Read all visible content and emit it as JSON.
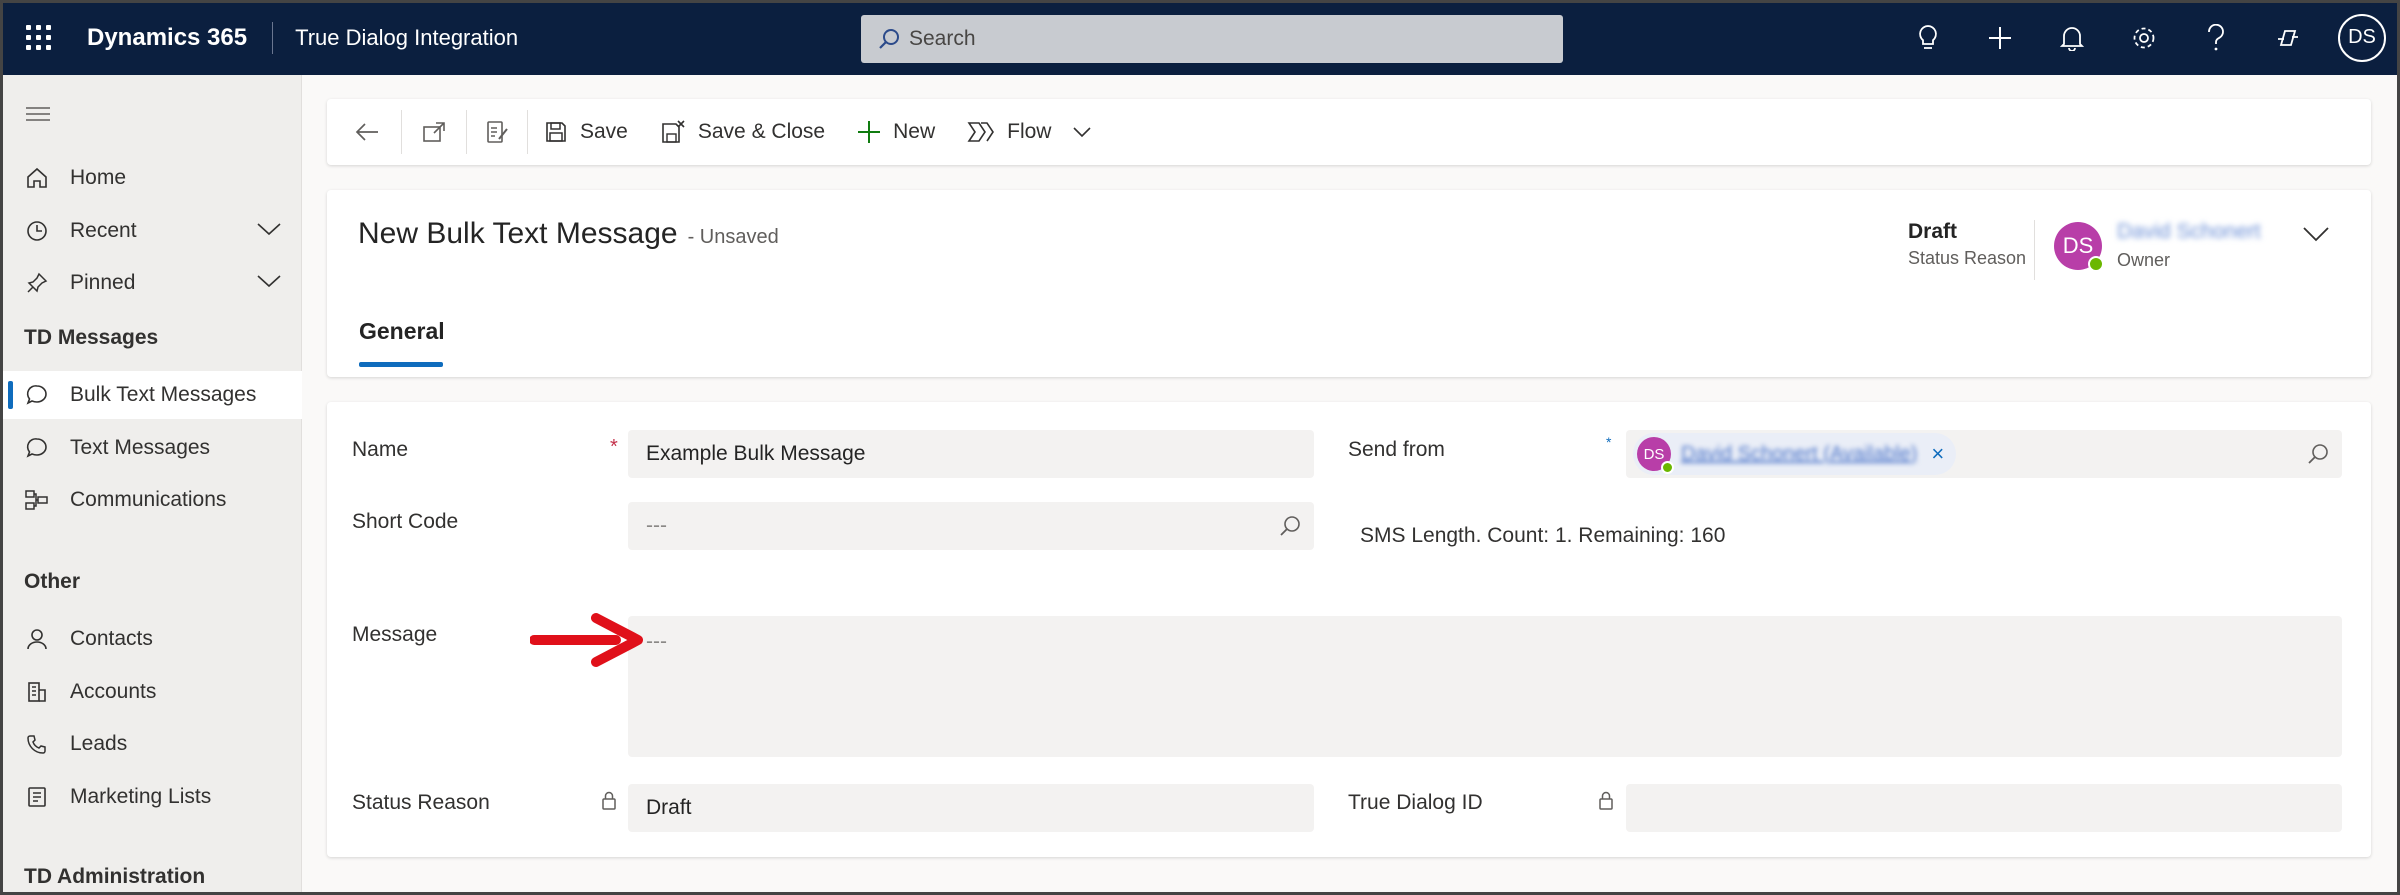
{
  "topbar": {
    "app_name": "Dynamics 365",
    "environment": "True Dialog Integration",
    "search_placeholder": "Search",
    "user_initials": "DS"
  },
  "sidebar": {
    "items": [
      {
        "label": "Home"
      },
      {
        "label": "Recent"
      },
      {
        "label": "Pinned"
      }
    ],
    "groups": [
      {
        "title": "TD Messages",
        "items": [
          {
            "label": "Bulk Text Messages"
          },
          {
            "label": "Text Messages"
          },
          {
            "label": "Communications"
          }
        ]
      },
      {
        "title": "Other",
        "items": [
          {
            "label": "Contacts"
          },
          {
            "label": "Accounts"
          },
          {
            "label": "Leads"
          },
          {
            "label": "Marketing Lists"
          }
        ]
      },
      {
        "title": "TD Administration",
        "items": []
      }
    ]
  },
  "commandbar": {
    "save": "Save",
    "save_close": "Save & Close",
    "new": "New",
    "flow": "Flow"
  },
  "record": {
    "title": "New Bulk Text Message",
    "unsaved": "- Unsaved",
    "status_value": "Draft",
    "status_label": "Status Reason",
    "owner_initials": "DS",
    "owner_name": "David Schonert",
    "owner_label": "Owner",
    "tab": "General"
  },
  "form": {
    "name_label": "Name",
    "name_value": "Example Bulk Message",
    "send_from_label": "Send from",
    "send_from_initials": "DS",
    "send_from_value": "David Schonert (Available)",
    "short_code_label": "Short Code",
    "short_code_value": "---",
    "sms_info": "SMS Length. Count: 1. Remaining: 160",
    "message_label": "Message",
    "message_value": "---",
    "status_reason_label": "Status Reason",
    "status_reason_value": "Draft",
    "true_dialog_id_label": "True Dialog ID",
    "true_dialog_id_value": ""
  },
  "colors": {
    "topbar_bg": "#0b1f3f",
    "accent": "#0f6cbd",
    "avatar": "#b83ea8",
    "required": "#c4314b",
    "annotation_arrow": "#e0101a"
  }
}
